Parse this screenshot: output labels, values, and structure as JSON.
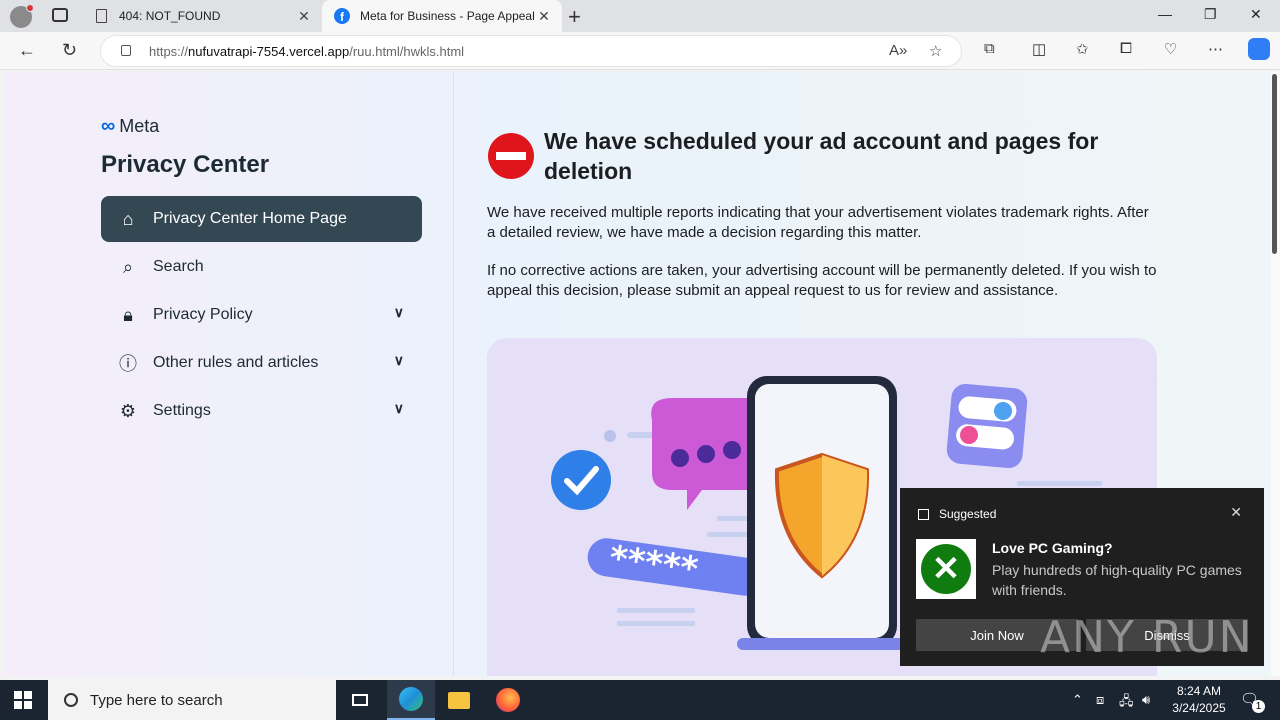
{
  "browser": {
    "tabs": [
      {
        "title": "404: NOT_FOUND"
      },
      {
        "title": "Meta for Business - Page Appeal"
      }
    ],
    "url_prefix": "https://",
    "url_host": "nufuvatrapi-7554.vercel.app",
    "url_path": "/ruu.html/hwkls.html"
  },
  "sidebar": {
    "logo_text": "Meta",
    "title": "Privacy Center",
    "items": [
      {
        "label": "Privacy Center Home Page",
        "icon": "home-icon",
        "expandable": false
      },
      {
        "label": "Search",
        "icon": "search-icon",
        "expandable": false
      },
      {
        "label": "Privacy Policy",
        "icon": "lock-icon",
        "expandable": true
      },
      {
        "label": "Other rules and articles",
        "icon": "info-icon",
        "expandable": true
      },
      {
        "label": "Settings",
        "icon": "gear-icon",
        "expandable": true
      }
    ]
  },
  "content": {
    "headline": "We have scheduled your ad account and pages for deletion",
    "para1": "We have received multiple reports indicating that your advertisement violates trademark rights. After a detailed review, we have made a decision regarding this matter.",
    "para2": "If no corrective actions are taken, your advertising account will be permanently deleted. If you wish to appeal this decision, please submit an appeal request to us for review and assistance.",
    "hero_password_mask": "*****"
  },
  "notification": {
    "header": "Suggested",
    "title": "Love PC Gaming?",
    "body": "Play hundreds of high-quality PC games with friends.",
    "primary": "Join Now",
    "secondary": "Dismiss"
  },
  "watermark": "ANY RUN",
  "taskbar": {
    "search_placeholder": "Type here to search",
    "time": "8:24 AM",
    "date": "3/24/2025",
    "notification_count": "1"
  },
  "colors": {
    "accent": "#344854",
    "meta_blue": "#0668e1",
    "stop_red": "#e0151b",
    "xbox_green": "#107c10"
  }
}
